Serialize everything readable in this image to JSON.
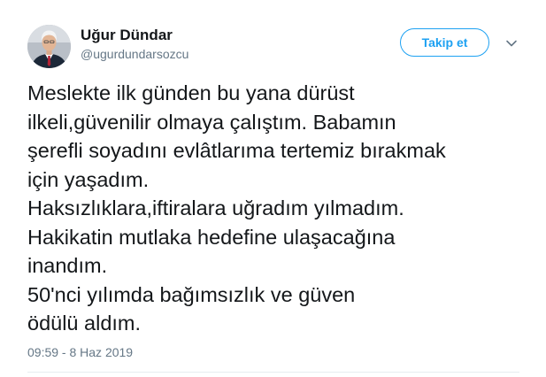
{
  "author": {
    "display_name": "Uğur Dündar",
    "handle": "@ugurdundarsozcu"
  },
  "actions": {
    "follow_label": "Takip et",
    "menu_icon": "chevron-down-icon"
  },
  "tweet": {
    "lines": [
      "Meslekte ilk günden bu yana dürüst",
      "ilkeli,güvenilir olmaya çalıştım. Babamın",
      "şerefli soyadını evlâtlarıma tertemiz bırakmak",
      "için yaşadım.",
      "Haksızlıklara,iftiralara uğradım yılmadım.",
      "Hakikatin mutlaka hedefine ulaşacağına",
      "inandım.",
      "50'nci yılımda bağımsızlık ve güven",
      "ödülü aldım."
    ],
    "timestamp": "09:59 - 8 Haz 2019"
  },
  "colors": {
    "accent": "#1da1f2",
    "text": "#14171a",
    "secondary_text": "#657786",
    "divider": "#e6ecf0"
  }
}
